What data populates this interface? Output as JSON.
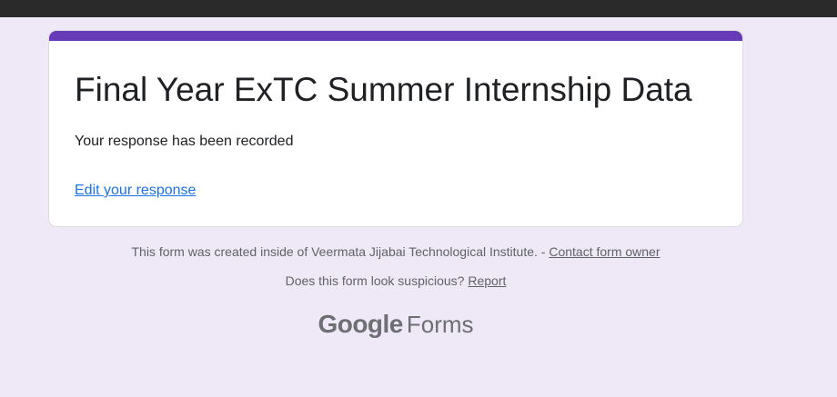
{
  "form": {
    "title": "Final Year ExTC Summer Internship Data",
    "confirmation": "Your response has been recorded",
    "edit_link": "Edit your response",
    "accent_color": "#673ab7"
  },
  "footer": {
    "created_text": "This form was created inside of Veermata Jijabai Technological Institute. - ",
    "contact_link": "Contact form owner",
    "suspicious_text": "Does this form look suspicious? ",
    "report_link": "Report"
  },
  "branding": {
    "brand": "Google",
    "product": "Forms"
  }
}
